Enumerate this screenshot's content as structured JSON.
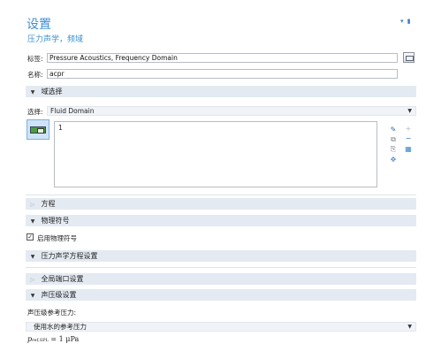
{
  "header": {
    "title": "设置",
    "subtitle": "压力声学，频域"
  },
  "fields": {
    "label_label": "标签:",
    "label_value": "Pressure Acoustics, Frequency Domain",
    "name_label": "名称:",
    "name_value": "acpr"
  },
  "sections": {
    "domain_selection": "域选择",
    "equation": "方程",
    "physics_symbols": "物理符号",
    "acoustics_equation_settings": "压力声学方程设置",
    "global_port_settings": "全局端口设置",
    "sound_level_settings": "声压级设置"
  },
  "domain_selection": {
    "selection_label": "选择:",
    "selection_value": "Fluid Domain",
    "list_items": [
      "1"
    ]
  },
  "physics_symbols": {
    "enable_label": "启用物理符号",
    "enabled": true
  },
  "sound_level": {
    "ref_pressure_label": "声压级参考压力:",
    "ref_pressure_option": "使用水的参考压力",
    "equation_var": "p",
    "equation_sub": "ref,SPL",
    "equation_rest": " = 1 μPa"
  },
  "icons": {
    "check_mark": "✓",
    "caret_down": "▼",
    "arrow_expanded": "▼",
    "arrow_collapsed": "▷",
    "pin": "▾ ▮",
    "tool_plus": "+",
    "tool_minus": "−",
    "tool_paste": "⎘",
    "tool_copy": "⧉",
    "tool_pick": "✎",
    "tool_move": "✥",
    "tool_color": "▦"
  }
}
